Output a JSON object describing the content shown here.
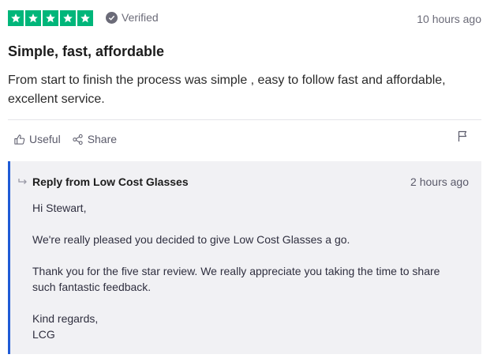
{
  "review": {
    "rating": 5,
    "rating_max": 5,
    "star_color": "#00b67a",
    "verified_label": "Verified",
    "date": "10 hours ago",
    "title": "Simple, fast, affordable",
    "text": "From start to finish the process was simple , easy to follow fast and affordable, excellent service."
  },
  "actions": {
    "useful_label": "Useful",
    "share_label": "Share"
  },
  "reply": {
    "header": "Reply from Low Cost Glasses",
    "date": "2 hours ago",
    "accent_color": "#1f5bd6",
    "paragraphs": [
      "Hi Stewart,",
      "We're really pleased you decided to give Low Cost Glasses a go.",
      "Thank you for the five star review. We really appreciate you taking the time to share such fantastic feedback."
    ],
    "signoff_1": "Kind regards,",
    "signoff_2": "LCG"
  }
}
